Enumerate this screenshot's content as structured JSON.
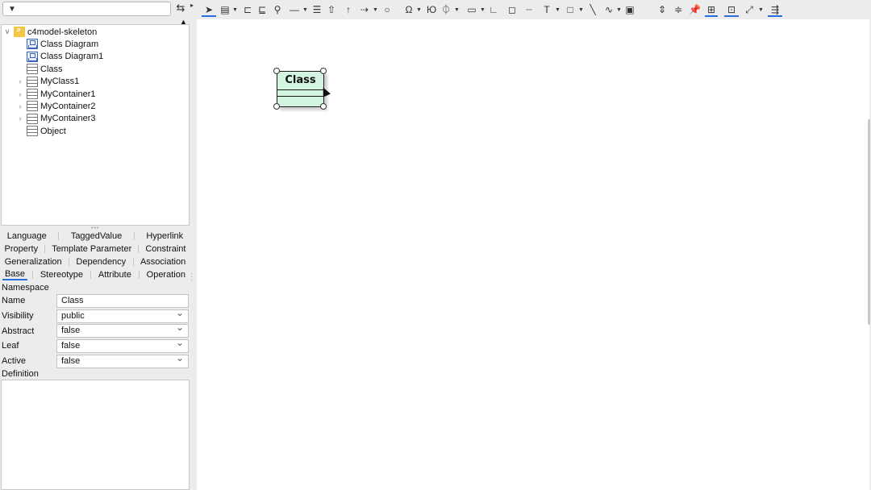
{
  "explorer": {
    "filter_placeholder": "",
    "tree": [
      {
        "label": "c4model-skeleton",
        "icon": "project-folder-icon",
        "twisty": "expanded"
      },
      {
        "label": "Class Diagram",
        "icon": "class-diagram-icon",
        "twisty": "none"
      },
      {
        "label": "Class Diagram1",
        "icon": "class-diagram-icon",
        "twisty": "none"
      },
      {
        "label": "Class",
        "icon": "class-icon",
        "twisty": "none"
      },
      {
        "label": "MyClass1",
        "icon": "class-icon",
        "twisty": "collapsed"
      },
      {
        "label": "MyContainer1",
        "icon": "class-icon",
        "twisty": "collapsed"
      },
      {
        "label": "MyContainer2",
        "icon": "class-icon",
        "twisty": "collapsed"
      },
      {
        "label": "MyContainer3",
        "icon": "class-icon",
        "twisty": "collapsed"
      },
      {
        "label": "Object",
        "icon": "class-icon",
        "twisty": "none"
      }
    ]
  },
  "tabs": {
    "row1": [
      "Language",
      "TaggedValue",
      "Hyperlink"
    ],
    "row2": [
      "Property",
      "Template Parameter",
      "Constraint"
    ],
    "row3": [
      "Generalization",
      "Dependency",
      "Association"
    ],
    "row4": [
      "Base",
      "Stereotype",
      "Attribute",
      "Operation"
    ],
    "active": "Base"
  },
  "properties": {
    "section": "Namespace",
    "name_label": "Name",
    "name_value": "Class",
    "visibility_label": "Visibility",
    "visibility_value": "public",
    "abstract_label": "Abstract",
    "abstract_value": "false",
    "leaf_label": "Leaf",
    "leaf_value": "false",
    "active_label": "Active",
    "active_value": "false",
    "definition_label": "Definition",
    "definition_value": ""
  },
  "diagram": {
    "class_name": "Class",
    "fill_color": "#d4f4e2"
  },
  "colors": {
    "accent": "#2b6fdc"
  }
}
